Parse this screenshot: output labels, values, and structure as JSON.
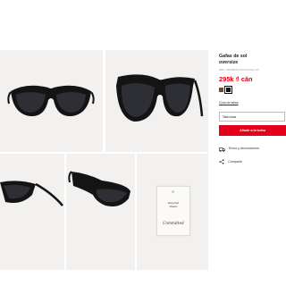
{
  "product": {
    "title_line1": "Gafas de sol",
    "title_line2": "oversize",
    "reference": "REF. 33069015-MCCAOGG-LR",
    "price": "295k ₫ căn",
    "colors": [
      {
        "name": "brown",
        "hex": "#6b4a32"
      },
      {
        "name": "black",
        "hex": "#111111"
      }
    ],
    "selected_color": "black"
  },
  "size": {
    "guide_link": "Guía de tallas",
    "selected": "Talla única"
  },
  "actions": {
    "add_to_bag": "Añadir a la bolsa",
    "shipping": "Envío y devoluciones",
    "share": "Compartir"
  },
  "gallery": {
    "tag_text_line1": "Recycled",
    "tag_text_line2": "Plastic",
    "tag_brand": "Committed"
  },
  "colors": {
    "accent": "#e2001a",
    "photo_bg": "#f2f1ef"
  }
}
